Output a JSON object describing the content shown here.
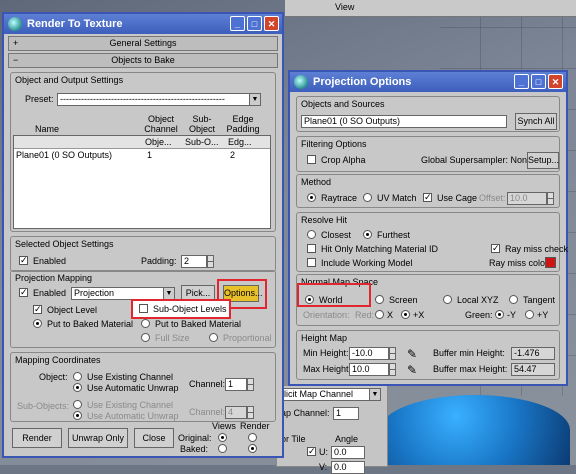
{
  "background": {
    "toolbar_label": "View",
    "panel": {
      "map_channel_drop": "licit Map Channel",
      "map_channel_label": "ap Channel:",
      "map_channel_val": "1",
      "tile_label": "or Tile",
      "angle_label": "Angle",
      "u_label": "U:",
      "u_val": "0.0",
      "v_label": "V:",
      "v_val": "0.0"
    }
  },
  "rtt": {
    "title": "Render To Texture",
    "rollouts": [
      {
        "sign": "+",
        "label": "General Settings"
      },
      {
        "sign": "−",
        "label": "Objects to Bake"
      }
    ],
    "obj_output": {
      "label": "Object and Output Settings",
      "preset_label": "Preset:",
      "preset_value": "-------------------------------------------------------"
    },
    "table": {
      "headers": {
        "name": "Name",
        "object_channel": "Object Channel",
        "subobject_channel": "Sub-Object Channel",
        "edge_padding": "Edge Padding"
      },
      "header_row": [
        "Obje...",
        "Sub-O...",
        "Edg..."
      ],
      "rows": [
        {
          "name": "Plane01 (0 SO Outputs)",
          "obj": "1",
          "sub": "",
          "edge": "2"
        }
      ]
    },
    "selected": {
      "label": "Selected Object Settings",
      "enabled": "Enabled",
      "padding_label": "Padding:",
      "padding_value": "2"
    },
    "projection": {
      "label": "Projection Mapping",
      "enabled": "Enabled",
      "drop_value": "Projection",
      "pick": "Pick...",
      "options": "Options...",
      "object_level": "Object Level",
      "sub_object_levels": "Sub-Object Levels",
      "put_baked": "Put to Baked Material",
      "put_baked2": "Put to Baked Material",
      "full_size": "Full Size",
      "proportional": "Proportional"
    },
    "mapping": {
      "label": "Mapping Coordinates",
      "object_label": "Object:",
      "use_existing": "Use Existing Channel",
      "use_auto": "Use Automatic Unwrap",
      "channel_label": "Channel:",
      "channel_value": "1",
      "subobj_label": "Sub-Objects:",
      "sub_use_existing": "Use Existing Channel",
      "sub_use_auto": "Use Automatic Unwrap",
      "sub_channel_label": "Channel:",
      "sub_channel_value": "4"
    },
    "bottom": {
      "render": "Render",
      "unwrap": "Unwrap Only",
      "close": "Close",
      "views_label": "Views",
      "render_label": "Render",
      "original_label": "Original:",
      "baked_label": "Baked:"
    }
  },
  "proj": {
    "title": "Projection Options",
    "sources": {
      "label": "Objects and Sources",
      "field": "Plane01 (0 SO Outputs)",
      "synch": "Synch All"
    },
    "filtering": {
      "label": "Filtering Options",
      "crop_alpha": "Crop Alpha",
      "global_ss": "Global Supersampler: None",
      "setup": "Setup..."
    },
    "method": {
      "label": "Method",
      "raytrace": "Raytrace",
      "uv_match": "UV Match",
      "use_cage": "Use Cage",
      "offset_label": "Offset:",
      "offset_value": "10.0"
    },
    "resolve": {
      "label": "Resolve Hit",
      "closest": "Closest",
      "furthest": "Furthest",
      "only_matching": "Hit Only Matching Material ID",
      "ray_miss_check": "Ray miss check",
      "include_working": "Include Working Model",
      "ray_miss_color": "Ray miss color:",
      "color": "#d01313"
    },
    "normal": {
      "label": "Normal Map Space",
      "world": "World",
      "screen": "Screen",
      "local": "Local XYZ",
      "tangent": "Tangent",
      "orientation_label": "Orientation:",
      "red_label": "Red:",
      "x_neg": "X",
      "x_pos": "+X",
      "green_label": "Green:",
      "y_neg": "-Y",
      "y_pos": "+Y"
    },
    "height": {
      "label": "Height Map",
      "min_label": "Min Height:",
      "min_value": "-10.0",
      "max_label": "Max Height:",
      "max_value": "10.0",
      "buf_min_label": "Buffer min Height:",
      "buf_min_value": "-1.476",
      "buf_max_label": "Buffer max Height:",
      "buf_max_value": "54.47"
    }
  }
}
